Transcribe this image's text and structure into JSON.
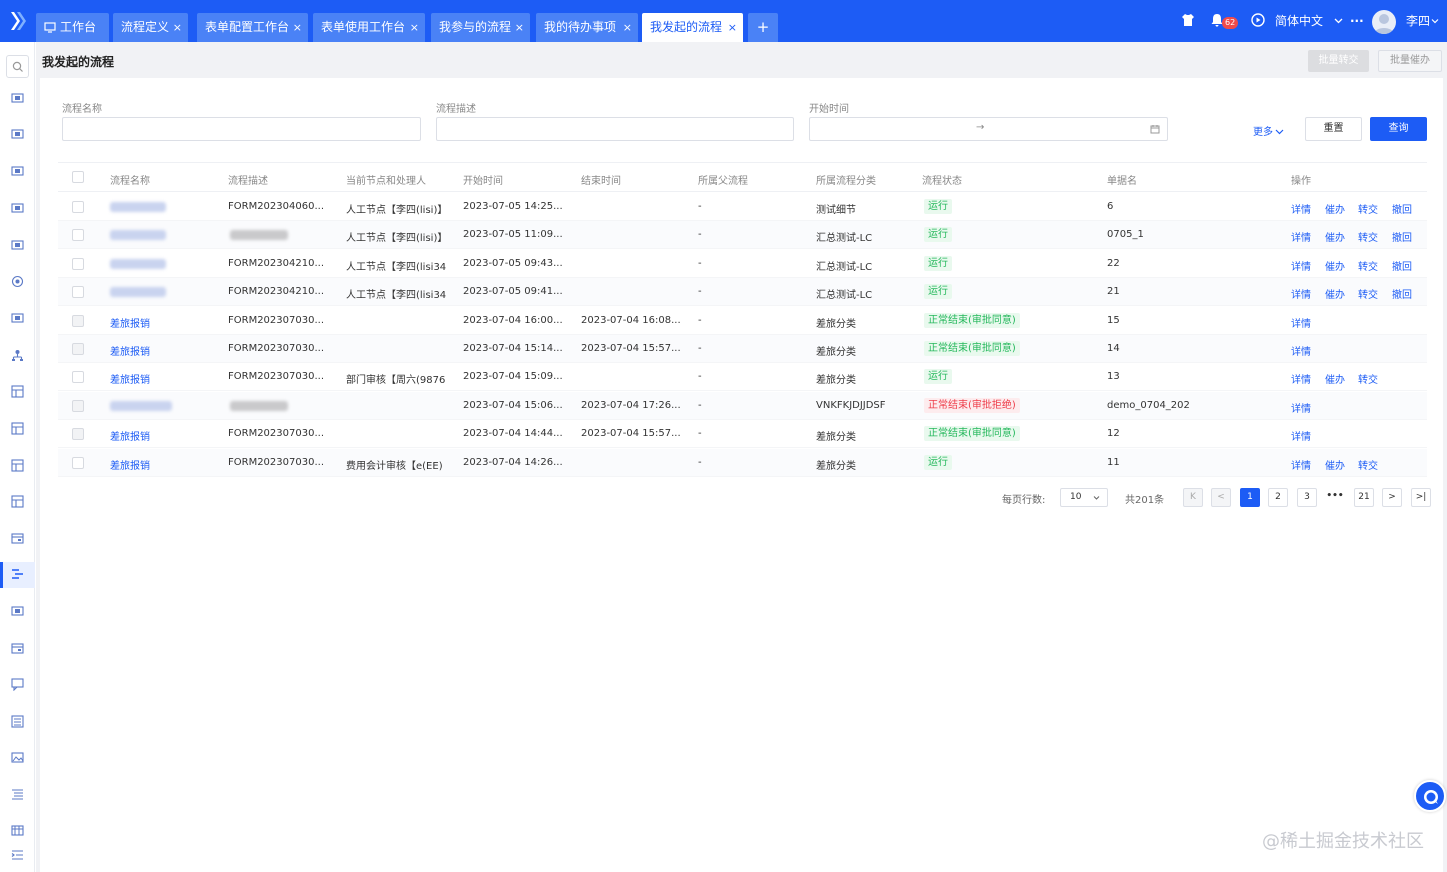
{
  "colors": {
    "brand": "#1d5cf5",
    "tab_inactive": "#4a82f6",
    "status_green": "#25b85c",
    "status_red": "#ee3d4a"
  },
  "tabs": [
    {
      "label": "工作台",
      "icon": "monitor-icon",
      "closable": false,
      "active": false
    },
    {
      "label": "流程定义",
      "closable": true,
      "active": false
    },
    {
      "label": "表单配置工作台",
      "closable": true,
      "active": false
    },
    {
      "label": "表单使用工作台",
      "closable": true,
      "active": false
    },
    {
      "label": "我参与的流程",
      "closable": true,
      "active": false
    },
    {
      "label": "我的待办事项",
      "closable": true,
      "active": false
    },
    {
      "label": "我发起的流程",
      "closable": true,
      "active": true
    }
  ],
  "tab_close_glyph": "×",
  "tab_add_glyph": "+",
  "header": {
    "notification_count": "62",
    "language": "简体中文",
    "more_glyph": "···",
    "user_name": "李四"
  },
  "page": {
    "title": "我发起的流程",
    "batch_transfer_label": "批量转交",
    "batch_urge_label": "批量催办"
  },
  "filters": {
    "name_label": "流程名称",
    "desc_label": "流程描述",
    "start_label": "开始时间",
    "range_sep": "→",
    "more_label": "更多",
    "reset_label": "重置",
    "query_label": "查询"
  },
  "table": {
    "columns": [
      "流程名称",
      "流程描述",
      "当前节点和处理人",
      "开始时间",
      "结束时间",
      "所属父流程",
      "所属流程分类",
      "流程状态",
      "单据名",
      "操作"
    ],
    "rows": [
      {
        "name": "",
        "name_blurred": true,
        "desc": "FORM202304060...",
        "node": "人工节点【李四(lisi)】",
        "start": "2023-07-05 14:25...",
        "end": "",
        "parent": "-",
        "category": "测试细节",
        "status": "运行",
        "status_type": "run",
        "doc": "6",
        "ops": [
          "详情",
          "催办",
          "转交",
          "撤回"
        ],
        "disabled": false
      },
      {
        "name": "",
        "name_blurred": true,
        "desc": "",
        "desc_blurred": true,
        "node": "人工节点【李四(lisi)】",
        "start": "2023-07-05 11:09...",
        "end": "",
        "parent": "-",
        "category": "汇总测试-LC",
        "status": "运行",
        "status_type": "run",
        "doc": "0705_1",
        "ops": [
          "详情",
          "催办",
          "转交",
          "撤回"
        ],
        "disabled": false
      },
      {
        "name": "",
        "name_blurred": true,
        "desc": "FORM202304210...",
        "node": "人工节点【李四(lisi34",
        "start": "2023-07-05 09:43...",
        "end": "",
        "parent": "-",
        "category": "汇总测试-LC",
        "status": "运行",
        "status_type": "run",
        "doc": "22",
        "ops": [
          "详情",
          "催办",
          "转交",
          "撤回"
        ],
        "disabled": false
      },
      {
        "name": "",
        "name_blurred": true,
        "desc": "FORM202304210...",
        "node": "人工节点【李四(lisi34",
        "start": "2023-07-05 09:41...",
        "end": "",
        "parent": "-",
        "category": "汇总测试-LC",
        "status": "运行",
        "status_type": "run",
        "doc": "21",
        "ops": [
          "详情",
          "催办",
          "转交",
          "撤回"
        ],
        "disabled": false
      },
      {
        "name": "差旅报销",
        "desc": "FORM202307030...",
        "node": "",
        "start": "2023-07-04 16:00...",
        "end": "2023-07-04 16:08...",
        "parent": "-",
        "category": "差旅分类",
        "status": "正常结束(审批同意)",
        "status_type": "ok",
        "doc": "15",
        "ops": [
          "详情"
        ],
        "disabled": true
      },
      {
        "name": "差旅报销",
        "desc": "FORM202307030...",
        "node": "",
        "start": "2023-07-04 15:14...",
        "end": "2023-07-04 15:57...",
        "parent": "-",
        "category": "差旅分类",
        "status": "正常结束(审批同意)",
        "status_type": "ok",
        "doc": "14",
        "ops": [
          "详情"
        ],
        "disabled": true
      },
      {
        "name": "差旅报销",
        "desc": "FORM202307030...",
        "node": "部门审核【周六(9876",
        "start": "2023-07-04 15:09...",
        "end": "",
        "parent": "-",
        "category": "差旅分类",
        "status": "运行",
        "status_type": "run",
        "doc": "13",
        "ops": [
          "详情",
          "催办",
          "转交"
        ],
        "disabled": false
      },
      {
        "name": "",
        "name_blurred": true,
        "desc": "",
        "desc_blurred": true,
        "node": "",
        "start": "2023-07-04 15:06...",
        "end": "2023-07-04 17:26...",
        "parent": "-",
        "category": "VNKFKJDJJDSF",
        "status": "正常结束(审批拒绝)",
        "status_type": "rej",
        "doc": "demo_0704_202",
        "ops": [
          "详情"
        ],
        "disabled": true
      },
      {
        "name": "差旅报销",
        "desc": "FORM202307030...",
        "node": "",
        "start": "2023-07-04 14:44...",
        "end": "2023-07-04 15:57...",
        "parent": "-",
        "category": "差旅分类",
        "status": "正常结束(审批同意)",
        "status_type": "ok",
        "doc": "12",
        "ops": [
          "详情"
        ],
        "disabled": true
      },
      {
        "name": "差旅报销",
        "desc": "FORM202307030...",
        "node": "费用会计审核【e(EE)",
        "start": "2023-07-04 14:26...",
        "end": "",
        "parent": "-",
        "category": "差旅分类",
        "status": "运行",
        "status_type": "run",
        "doc": "11",
        "ops": [
          "详情",
          "催办",
          "转交"
        ],
        "disabled": false
      }
    ]
  },
  "pagination": {
    "rows_per_page_label": "每页行数:",
    "rows_per_page": "10",
    "total_label": "共201条",
    "pages": [
      "1",
      "2",
      "3",
      "•••",
      "21"
    ],
    "current": "1",
    "first_glyph": "K",
    "prev_glyph": "<",
    "next_glyph": ">",
    "last_glyph": ">|"
  },
  "watermark": "@稀土掘金技术社区",
  "sidebar_icons": [
    "search-icon",
    "screen-icon",
    "screen-icon",
    "screen-icon",
    "screen-icon",
    "screen-icon",
    "target-icon",
    "screen-icon",
    "org-chart-icon",
    "grid-icon",
    "grid-icon",
    "grid-icon",
    "grid-icon",
    "card-icon",
    "list-flow-icon",
    "screen-icon",
    "card-icon",
    "chat-icon",
    "table-icon",
    "image-icon",
    "list-icon",
    "calendar-icon",
    "indent-icon"
  ]
}
